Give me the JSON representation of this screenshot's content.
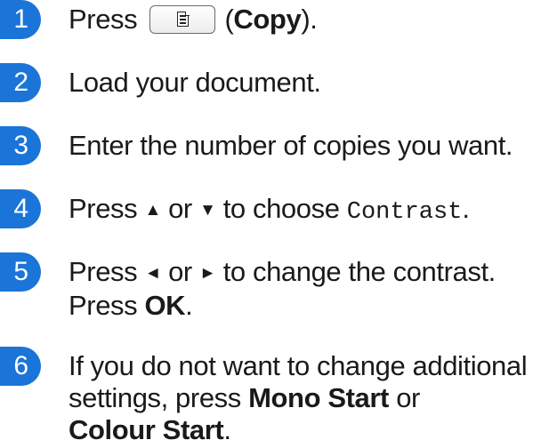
{
  "steps": [
    {
      "number": "1",
      "press": "Press",
      "copy_button_icon": "copy-document-icon",
      "paren_open": "(",
      "copy_label": "Copy",
      "paren_close": ")."
    },
    {
      "number": "2",
      "text": "Load your document."
    },
    {
      "number": "3",
      "text": "Enter the number of copies you want."
    },
    {
      "number": "4",
      "press": "Press",
      "up_arrow": "▲",
      "or": "or",
      "down_arrow": "▼",
      "to_choose": "to choose",
      "menu_item": "Contrast",
      "period": "."
    },
    {
      "number": "5",
      "press": "Press",
      "left_arrow": "◄",
      "or": "or",
      "right_arrow": "►",
      "action": "to change the contrast.",
      "press2": "Press",
      "ok_label": "OK",
      "period": "."
    },
    {
      "number": "6",
      "line1": "If you do not want to change additional",
      "line2_prefix": "settings, press",
      "mono_start": "Mono Start",
      "or": "or",
      "colour_start": "Colour Start",
      "period": "."
    }
  ],
  "colors": {
    "badge": "#1b74d8",
    "text": "#1a1a1a"
  }
}
